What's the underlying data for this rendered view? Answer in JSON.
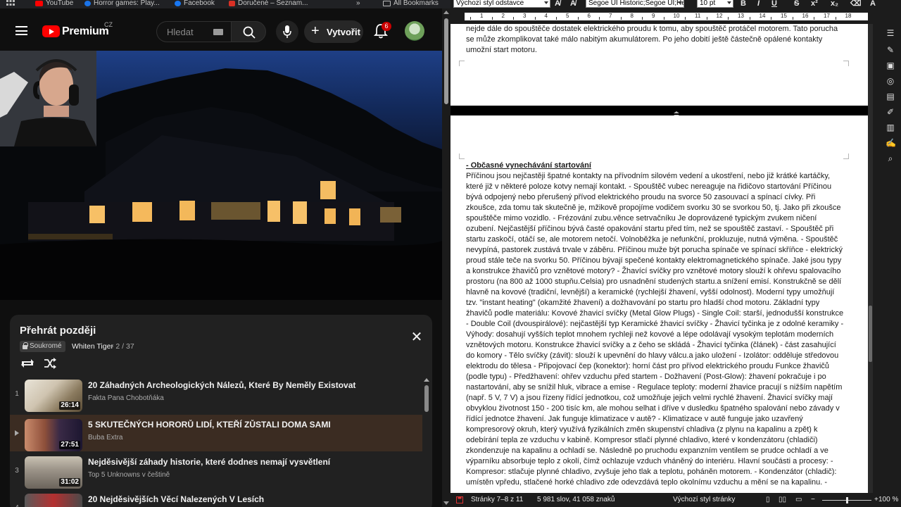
{
  "bookmarks_bar": {
    "items": [
      {
        "label": "YouTube",
        "color": "#ff0000"
      },
      {
        "label": "Horror games: Play...",
        "color": "#1a73e8"
      },
      {
        "label": "Facebook",
        "color": "#1877f2"
      },
      {
        "label": "Doručené – Seznam...",
        "color": "#d93025"
      }
    ],
    "overflow": "»",
    "all_bookmarks": "All Bookmarks"
  },
  "youtube": {
    "logo_text": "Premium",
    "country": "CZ",
    "search_placeholder": "Hledat",
    "create_label": "Vytvořit",
    "notification_count": "6"
  },
  "playlist": {
    "title": "Přehrát později",
    "privacy": "Soukromé",
    "owner": "Whiten Tiger",
    "position": "- 2 / 37",
    "items": [
      {
        "index": "1",
        "title": "20 Záhadných Archeologických Nálezů, Které By Neměly Existovat",
        "channel": "Fakta Pana Chobotňáka",
        "duration": "26:14",
        "active": false
      },
      {
        "index": "",
        "title": "5 SKUTEČNÝCH HORORŮ LIDÍ, KTEŘÍ ZŮSTALI DOMA SAMI",
        "channel": "Buba Extra",
        "duration": "27:51",
        "active": true
      },
      {
        "index": "3",
        "title": "Nejděsivější záhady historie, které dodnes nemají vysvětlení",
        "channel": "Top 5 Unknowns v češtině",
        "duration": "31:02",
        "active": false
      },
      {
        "index": "4",
        "title": "20 Nejděsivějších Věcí Nalezených V Lesích",
        "channel": "",
        "duration": "",
        "active": false
      }
    ]
  },
  "writer": {
    "paragraph_style": "Výchozí styl odstavce",
    "font_name": "Segoe UI Historic;Segoe UI;Hel",
    "font_size": "10 pt",
    "format_buttons": [
      "B",
      "I",
      "U",
      "S",
      "x²",
      "x₂",
      "A"
    ],
    "ruler_numbers": [
      "1",
      "2",
      "3",
      "4",
      "5",
      "6",
      "7",
      "8",
      "9",
      "10",
      "11",
      "12",
      "13",
      "14",
      "15",
      "16",
      "17",
      "18"
    ],
    "page1_text": "nejde dále do spouštěče dostatek elektrického proudu k tomu, aby spouštěč protáčel motorem. Tato porucha se může zkomplikovat také málo nabitým akumulátorem. Po jeho dobití ještě částečně opálené kontakty umožní start motoru.",
    "page2_heading": "- Občasné vynechávání startování",
    "page2_text": "Příčinou jsou nejčastěji špatné kontakty na přívodním silovém vedení a ukostření, nebo již krátké kartáčky, které již v některé poloze kotvy nemají kontakt. - Spouštěč vubec nereaguje na řidičovo startování Příčinou bývá odpojený nebo přerušený přívod elektrického proudu na svorce 50 zasouvací a spínací cívky. Při zkoušce, zda tomu tak skutečně je, mžikově propojíme vodičem svorku 30 se svorkou 50, tj. Jako při zkoušce spouštěče mimo vozidlo. - Frézování zubu.věnce setrvačníku Je doprovázené typickým zvukem ničení ozubení. Nejčastější příčinou bývá časté opakování startu před tím, než se spouštěč zastaví. - Spouštěč při startu zaskočí, otáčí se, ale motorem netočí. Volnoběžka je nefunkční, prokluzuje, nutná výměna. - Spouštěč nevypíná, pastorek zustává trvale v záběru. Příčinou muže být porucha spínače ve spínací skříňce - elektrický proud stále teče na svorku 50. Příčinou bývají spečené kontakty elektromagnetického spínače. Jaké jsou typy a konstrukce žhavičů pro vznětové motory? - Žhavící svíčky pro vznětové motory slouží k ohřevu spalovacího prostoru (na 800 až 1000 stupňu.Celsia) pro usnadnění studených startu.a snížení emisí. Konstrukčně se dělí hlavně na kovové (tradiční, levnější) a keramické (rychlejší žhavení, vyšší odolnost). Moderní typy umožňují tzv. \"instant heating\" (okamžité žhavení) a dožhavování po startu pro hladší chod motoru. Základní typy žhavičů podle materiálu: Kovové žhavicí svíčky (Metal Glow Plugs) - Single Coil: starší, jednodušší konstrukce - Double Coil (dvouspirálové): nejčastější typ Keramické žhavicí svíčky - Žhavicí tyčinka je z odolné keramiky - Výhody: dosahují vyšších teplot mnohem rychleji než kovové a lépe odolávají vysokým teplotám moderních vznětových motoru. Konstrukce žhavicí svíčky a z čeho se skládá - Žhavicí tyčinka (článek) - část zasahující do komory - Tělo svíčky (závit): slouží k upevnění do hlavy válcu.a jako uložení - Izolátor: odděluje středovou elektrodu do tělesa - Připojovací čep (konektor): horní část pro přívod elektrického proudu Funkce žhavičů (podle typu) - Předžhavení: ohřev vzduchu před startem - Dožhavení (Post-Glow): žhavení pokračuje i po nastartování, aby se snížil hluk, vibrace a emise - Regulace teploty: moderní žhavice pracují s nižším napětím (např. 5 V, 7 V) a jsou řízeny řídící jednotkou, což umožňuje jejich velmi rychlé žhavení. Žhavicí svíčky mají obvyklou životnost 150 - 200 tisíc km, ale mohou selhat i dříve v dusledku špatného spalování nebo závady v řídící jednotce žhavení. Jak funguje klimatizace v autě? - Klimatizace v autě funguje jako uzavřený kompresorový okruh, který využívá fyzikálních změn skupenství chladiva (z plynu na kapalinu a zpět) k odebírání tepla ze vzduchu v kabině. Kompresor stlačí plynné chladivo, které v kondenzátoru (chladiči) zkondenzuje na kapalinu a ochladí se. Následně po pruchodu expanzním ventilem se prudce ochladí a ve výparníku absorbuje teplo z okolí, čímž ochlazuje vzduch vháněný do interiéru. Hlavní součásti a procesy: - Kompresor: stlačuje plynné chladivo, zvyšuje jeho tlak a teplotu, poháněn motorem. - Kondenzátor (chladič): umístěn vpředu, stlačené horké chladivo zde odevzdává teplo okolnímu vzduchu a mění se na kapalinu. -",
    "status": {
      "pages": "Stránky 7–8 z 11",
      "words": "5 981 slov, 41 058 znaků",
      "page_style": "Výchozí styl stránky",
      "zoom": "100 %"
    }
  },
  "colors": {
    "youtube_red": "#ff0000",
    "badge_red": "#cc0000",
    "active_row": "#3b2c22"
  }
}
